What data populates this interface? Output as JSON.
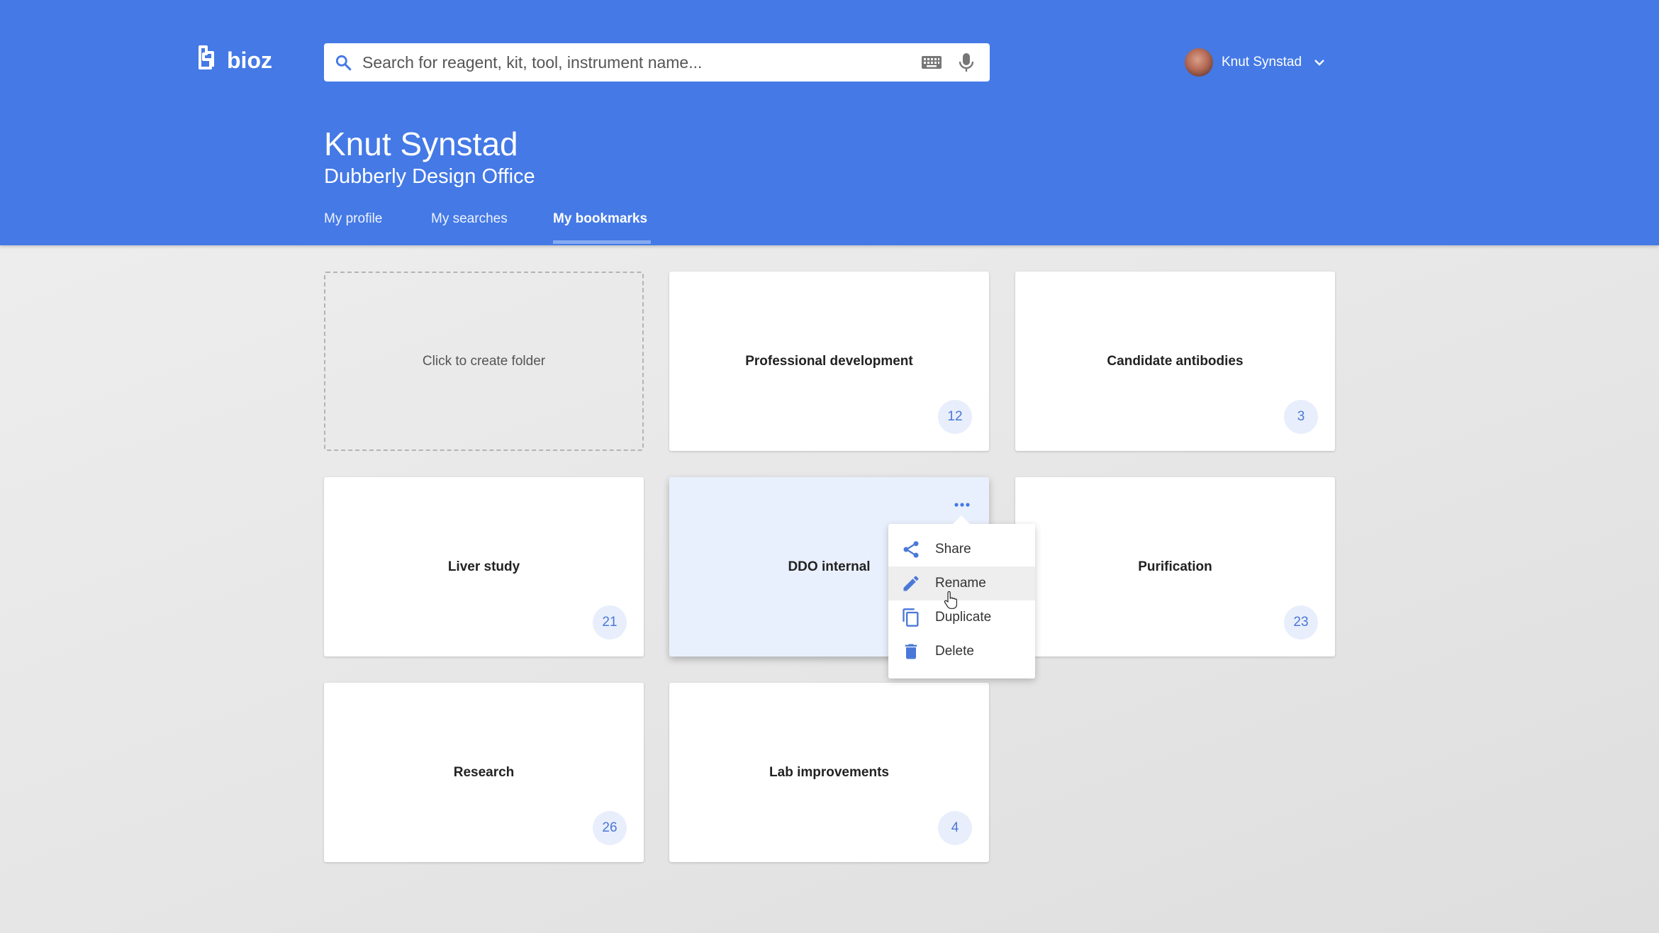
{
  "header": {
    "logo_text": "bioz",
    "search": {
      "placeholder": "Search for reagent, kit, tool, instrument name...",
      "value": ""
    },
    "user": {
      "name": "Knut Synstad"
    }
  },
  "profile": {
    "name": "Knut Synstad",
    "organization": "Dubberly Design Office"
  },
  "tabs": [
    {
      "label": "My profile",
      "active": false
    },
    {
      "label": "My searches",
      "active": false
    },
    {
      "label": "My bookmarks",
      "active": true
    }
  ],
  "folders": {
    "create_label": "Click to create folder",
    "items": [
      {
        "name": "Professional development",
        "count": "12"
      },
      {
        "name": "Candidate antibodies",
        "count": "3"
      },
      {
        "name": "Liver study",
        "count": "21"
      },
      {
        "name": "DDO internal",
        "count": ""
      },
      {
        "name": "Purification",
        "count": "23"
      },
      {
        "name": "Research",
        "count": "26"
      },
      {
        "name": "Lab improvements",
        "count": "4"
      }
    ]
  },
  "context_menu": {
    "items": [
      {
        "label": "Share",
        "icon": "share-icon"
      },
      {
        "label": "Rename",
        "icon": "pencil-icon"
      },
      {
        "label": "Duplicate",
        "icon": "copy-icon"
      },
      {
        "label": "Delete",
        "icon": "trash-icon"
      }
    ]
  },
  "colors": {
    "header_bg": "#4479e6",
    "accent": "#4a78d8",
    "count_bg": "#e8eefb",
    "highlight_card": "#e9f0fd"
  }
}
